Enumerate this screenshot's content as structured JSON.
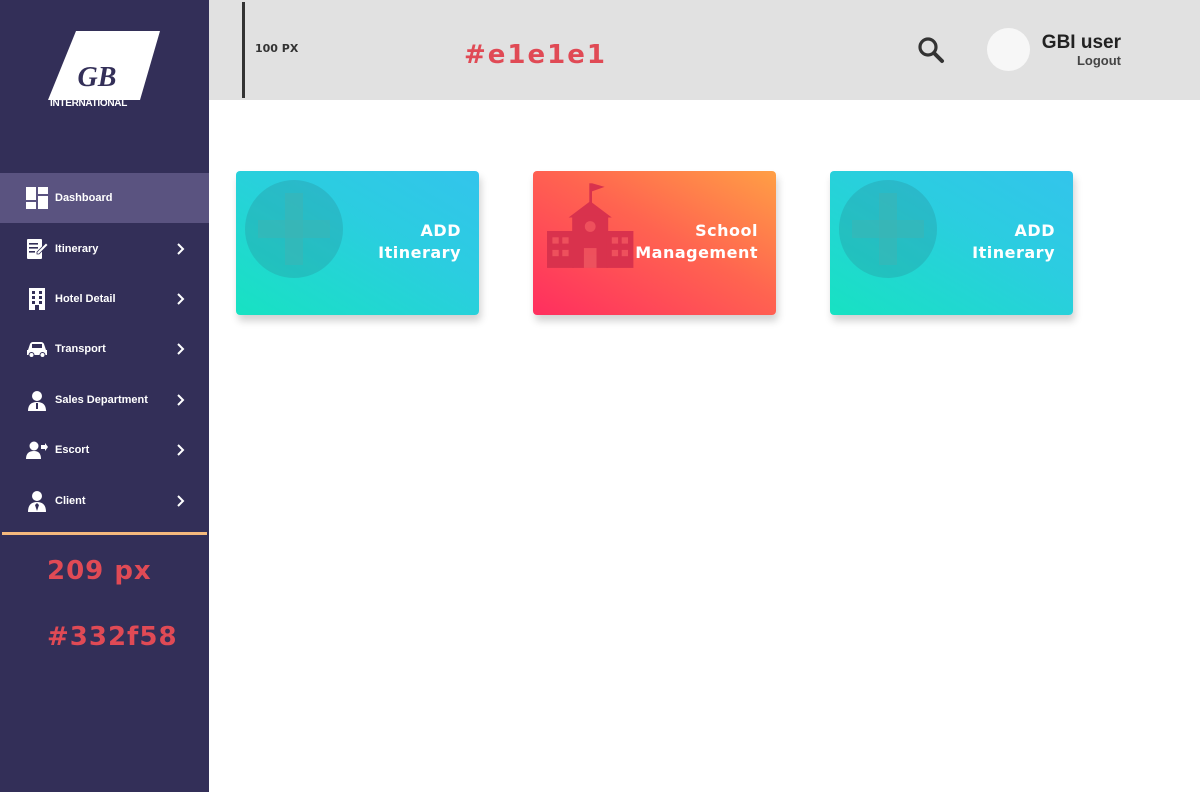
{
  "brand": {
    "logo_letters": "GB",
    "logo_text": "INTERNATIONAL"
  },
  "sidebar": {
    "items": [
      {
        "label": "Dashboard",
        "icon": "dashboard-icon",
        "active": true
      },
      {
        "label": "Itinerary",
        "icon": "itinerary-icon"
      },
      {
        "label": "Hotel Detail",
        "icon": "hotel-icon"
      },
      {
        "label": "Transport",
        "icon": "car-icon"
      },
      {
        "label": "Sales Department",
        "icon": "salesperson-icon"
      },
      {
        "label": "Escort",
        "icon": "escort-icon"
      },
      {
        "label": "Client",
        "icon": "client-icon"
      }
    ]
  },
  "annotations": {
    "active_color": "#5a5380",
    "sidebar_width": "209 px",
    "sidebar_color": "#332f58",
    "header_height": "100 PX",
    "header_color": "#e1e1e1"
  },
  "header": {
    "user_name": "GBI user",
    "logout_label": "Logout",
    "search_icon": "search-icon"
  },
  "cards": [
    {
      "title_line1": "ADD",
      "title_line2": "Itinerary",
      "icon": "plus-circle-icon",
      "gradient": [
        "#17e2c2",
        "#33c4ec"
      ]
    },
    {
      "title_line1": "School",
      "title_line2": "Management",
      "icon": "school-icon",
      "gradient": [
        "#ff2e5f",
        "#ff9f45"
      ]
    },
    {
      "title_line1": "ADD",
      "title_line2": "Itinerary",
      "icon": "plus-circle-icon",
      "gradient": [
        "#17e2c2",
        "#33c4ec"
      ]
    }
  ],
  "colors": {
    "sidebar_bg": "#332f58",
    "active_bg": "#5a5380",
    "header_bg": "#e1e1e1",
    "accent_line": "#f5b97d",
    "annotation_red": "#e04a55"
  }
}
